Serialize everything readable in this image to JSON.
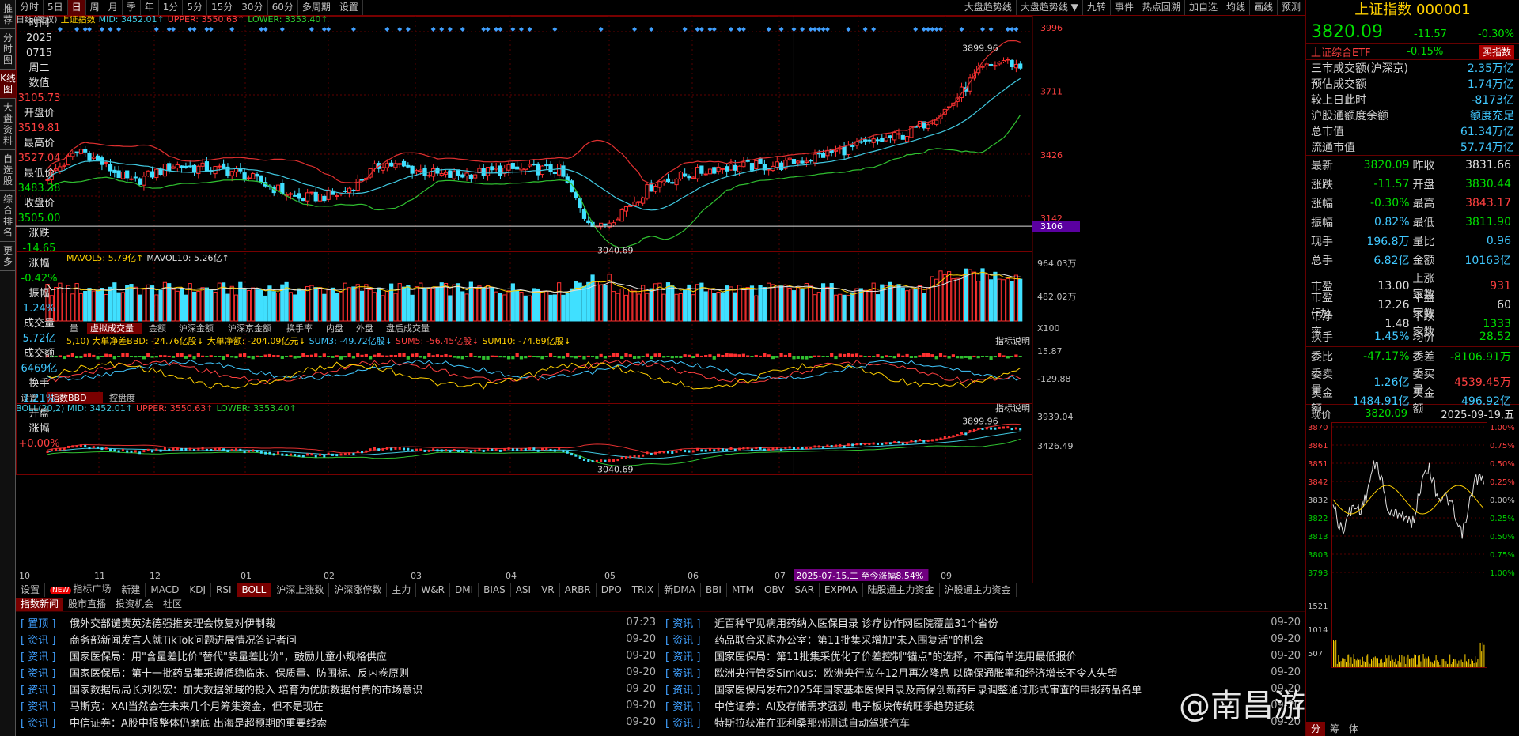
{
  "left_tabs": [
    "推荐",
    "分时图",
    "K线图",
    "大盘资料",
    "自选股",
    "综合排名",
    "更多"
  ],
  "left_tab_active": 2,
  "toolbar": {
    "periods": [
      "分时",
      "5日",
      "日",
      "周",
      "月",
      "季",
      "年",
      "1分",
      "5分",
      "15分",
      "30分",
      "60分",
      "多周期",
      "设置"
    ],
    "active_period": 2,
    "right_items": [
      "大盘趋势线",
      "大盘趋势线 ▼",
      "九转",
      "事件",
      "热点回溯",
      "加自选",
      "均线",
      "画线",
      "预测"
    ]
  },
  "info_col": [
    {
      "t": "时间",
      "c": "label"
    },
    {
      "t": "2025",
      "c": "label"
    },
    {
      "t": "0715",
      "c": "label"
    },
    {
      "t": "周二",
      "c": "label"
    },
    {
      "t": "数值",
      "c": "label"
    },
    {
      "t": "3105.73",
      "c": "red"
    },
    {
      "t": "开盘价",
      "c": "label"
    },
    {
      "t": "3519.81",
      "c": "red"
    },
    {
      "t": "最高价",
      "c": "label"
    },
    {
      "t": "3527.04",
      "c": "red"
    },
    {
      "t": "最低价",
      "c": "label"
    },
    {
      "t": "3483.38",
      "c": "green"
    },
    {
      "t": "收盘价",
      "c": "label"
    },
    {
      "t": "3505.00",
      "c": "green"
    },
    {
      "t": "涨跌",
      "c": "label"
    },
    {
      "t": "-14.65",
      "c": "green"
    },
    {
      "t": "涨幅",
      "c": "label"
    },
    {
      "t": "-0.42%",
      "c": "green"
    },
    {
      "t": "振幅",
      "c": "label"
    },
    {
      "t": "1.24%",
      "c": "cyan"
    },
    {
      "t": "成交量",
      "c": "label"
    },
    {
      "t": "5.72亿",
      "c": "cyan"
    },
    {
      "t": "成交额",
      "c": "label"
    },
    {
      "t": "6469亿",
      "c": "cyan"
    },
    {
      "t": "换手",
      "c": "label"
    },
    {
      "t": "1.21%",
      "c": "cyan"
    },
    {
      "t": "开盘",
      "c": "label"
    },
    {
      "t": "涨幅",
      "c": "label"
    },
    {
      "t": "+0.00%",
      "c": "red"
    }
  ],
  "main_legend": {
    "prefix": "日线(复权)",
    "name": "上证指数",
    "mid": "MID: 3452.01↑",
    "upper": "UPPER: 3550.63↑",
    "lower": "LOWER: 3353.40↑"
  },
  "vol_legend": {
    "mavol5": "MAVOL5: 5.79亿↑",
    "mavol10": "MAVOL10: 5.26亿↑"
  },
  "vol_tabs": [
    "量",
    "虚拟成交量",
    "金额",
    "沪深金额",
    "沪深京金额",
    "换手率",
    "内盘",
    "外盘",
    "盘后成交量"
  ],
  "vol_tabs_active": 1,
  "bbd_legend": {
    "a": "5,10) 大单净差BBD: -24.76亿股↓",
    "b": "大单净额: -204.09亿元↓",
    "c": "SUM3: -49.72亿股↓",
    "d": "SUM5: -56.45亿股↓",
    "e": "SUM10: -74.69亿股↓",
    "help": "指标说明"
  },
  "bbd_tabs": [
    "设置",
    "指数BBD",
    "控盘度"
  ],
  "bbd_tabs_active": 1,
  "boll_legend": {
    "a": "BOLL(20,2) MID: 3452.01↑",
    "b": "UPPER: 3550.63↑",
    "c": "LOWER: 3353.40↑",
    "help": "指标说明"
  },
  "axis": {
    "main_ticks": [
      "3996",
      "3711",
      "3426",
      "3142"
    ],
    "cursor_price": "3106",
    "vol_ticks": [
      "964.03万",
      "482.02万",
      "X100"
    ],
    "bbd_ticks": [
      "15.87",
      "-129.88"
    ],
    "boll_ticks": [
      "3939.04",
      "3426.49"
    ],
    "months": [
      "10",
      "11",
      "12",
      "01",
      "02",
      "03",
      "04",
      "05",
      "06",
      "07",
      "08",
      "09"
    ],
    "range_label": "2025-07-15,二 至今涨幅8.54%"
  },
  "annotations": {
    "low": "3040.69",
    "high": "3899.96",
    "high2": "3899.96",
    "low2": "3040.69"
  },
  "ind_tabs": [
    "设置",
    "指标广场",
    "新建",
    "MACD",
    "KDJ",
    "RSI",
    "BOLL",
    "沪深上涨数",
    "沪深涨停数",
    "主力",
    "W&R",
    "DMI",
    "BIAS",
    "ASI",
    "VR",
    "ARBR",
    "DPO",
    "TRIX",
    "新DMA",
    "BBI",
    "MTM",
    "OBV",
    "SAR",
    "EXPMA",
    "陆股通主力资金",
    "沪股通主力资金"
  ],
  "ind_tabs_active": 6,
  "new_badge": "NEW",
  "news_tabs": [
    "指数新闻",
    "股市直播",
    "投资机会",
    "社区"
  ],
  "news_left": [
    {
      "tag": "[ 置顶 ]",
      "title": "俄外交部谴责英法德强推安理会恢复对伊制裁",
      "time": "07:23"
    },
    {
      "tag": "[ 资讯 ]",
      "title": "商务部新闻发言人就TikTok问题进展情况答记者问",
      "time": "09-20"
    },
    {
      "tag": "[ 资讯 ]",
      "title": "国家医保局：用\"含量差比价\"替代\"装量差比价\"，鼓励儿童小规格供应",
      "time": "09-20"
    },
    {
      "tag": "[ 资讯 ]",
      "title": "国家医保局：第十一批药品集采遵循稳临床、保质量、防围标、反内卷原则",
      "time": "09-20"
    },
    {
      "tag": "[ 资讯 ]",
      "title": "国家数据局局长刘烈宏：加大数据领域的投入 培育为优质数据付费的市场意识",
      "time": "09-20"
    },
    {
      "tag": "[ 资讯 ]",
      "title": "马斯克：XAI当然会在未来几个月筹集资金，但不是现在",
      "time": "09-20"
    },
    {
      "tag": "[ 资讯 ]",
      "title": "中信证券：A股中报整体仍磨底 出海是超预期的重要线索",
      "time": "09-20"
    }
  ],
  "news_right": [
    {
      "tag": "[ 资讯 ]",
      "title": "近百种罕见病用药纳入医保目录 诊疗协作网医院覆盖31个省份",
      "time": "09-20"
    },
    {
      "tag": "[ 资讯 ]",
      "title": "药品联合采购办公室：第11批集采增加\"未入围复活\"的机会",
      "time": "09-20"
    },
    {
      "tag": "[ 资讯 ]",
      "title": "国家医保局：第11批集采优化了价差控制\"锚点\"的选择，不再简单选用最低报价",
      "time": "09-20"
    },
    {
      "tag": "[ 资讯 ]",
      "title": "欧洲央行管委Simkus：欧洲央行应在12月再次降息 以确保通胀率和经济增长不令人失望",
      "time": "09-20"
    },
    {
      "tag": "[ 资讯 ]",
      "title": "国家医保局发布2025年国家基本医保目录及商保创新药目录调整通过形式审查的申报药品名单",
      "time": "09-20"
    },
    {
      "tag": "[ 资讯 ]",
      "title": "中信证券：AI及存储需求强劲 电子板块传统旺季趋势延续",
      "time": "09-20"
    },
    {
      "tag": "[ 资讯 ]",
      "title": "特斯拉获准在亚利桑那州测试自动驾驶汽车",
      "time": "09-20"
    }
  ],
  "watermark": "@南昌游资-谢老",
  "right_panel": {
    "title": "上证指数 000001",
    "price": "3820.09",
    "change": "-11.57",
    "change_pct": "-0.30%",
    "etf_name": "上证综合ETF",
    "etf_pct": "-0.15%",
    "etf_btn": "买指数",
    "stats1": [
      {
        "l": "三市成交额(沪深京)",
        "v": "2.35万亿",
        "c": "cyan"
      },
      {
        "l": "预估成交额",
        "v": "1.74万亿",
        "c": "cyan"
      },
      {
        "l": "较上日此时",
        "v": "-8173亿",
        "c": "cyan"
      },
      {
        "l": "沪股通额度余额",
        "v": "额度充足",
        "c": "cyan"
      },
      {
        "l": "总市值",
        "v": "61.34万亿",
        "c": "cyan"
      },
      {
        "l": "流通市值",
        "v": "57.74万亿",
        "c": "cyan"
      }
    ],
    "grid1": [
      [
        "最新",
        "3820.09",
        "green",
        "昨收",
        "3831.66",
        "white"
      ],
      [
        "涨跌",
        "-11.57",
        "green",
        "开盘",
        "3830.44",
        "green"
      ],
      [
        "涨幅",
        "-0.30%",
        "green",
        "最高",
        "3843.17",
        "red"
      ],
      [
        "振幅",
        "0.82%",
        "cyan",
        "最低",
        "3811.90",
        "green"
      ],
      [
        "现手",
        "196.8万",
        "cyan",
        "量比",
        "0.96",
        "cyan"
      ],
      [
        "总手",
        "6.82亿",
        "cyan",
        "金额",
        "10163亿",
        "cyan"
      ]
    ],
    "grid2": [
      [
        "市盈",
        "13.00",
        "white",
        "上涨家数",
        "931",
        "red"
      ],
      [
        "市盈(动)",
        "12.26",
        "white",
        "平盘家数",
        "60",
        "white"
      ],
      [
        "市净率",
        "1.48",
        "white",
        "下跌家数",
        "1333",
        "green"
      ],
      [
        "换手",
        "1.45%",
        "cyan",
        "均价",
        "28.52",
        "green"
      ]
    ],
    "grid3": [
      [
        "委比",
        "-47.17%",
        "green",
        "委差",
        "-8106.91万",
        "green"
      ],
      [
        "委卖量",
        "1.26亿",
        "cyan",
        "委买量",
        "4539.45万",
        "red"
      ],
      [
        "卖金额",
        "1484.91亿",
        "cyan",
        "买金额",
        "496.92亿",
        "cyan"
      ]
    ],
    "mini_head": {
      "label": "现价",
      "price": "3820.09",
      "date": "2025-09-19,五"
    },
    "mini_left_ticks": [
      "3870",
      "3861",
      "3851",
      "3842",
      "3832",
      "3822",
      "3813",
      "3803",
      "3793",
      "1521",
      "1014",
      "507"
    ],
    "mini_right_ticks": [
      "1.00%",
      "0.75%",
      "0.50%",
      "0.25%",
      "0.00%",
      "0.25%",
      "0.50%",
      "0.75%",
      "1.00%"
    ],
    "foot_tabs": [
      "分",
      "筹",
      "体"
    ]
  },
  "colors": {
    "up": "#ff3030",
    "down": "#40e0ff",
    "upper": "#e03030",
    "mid": "#40c8e0",
    "lower": "#30c030",
    "grid": "#600000"
  }
}
